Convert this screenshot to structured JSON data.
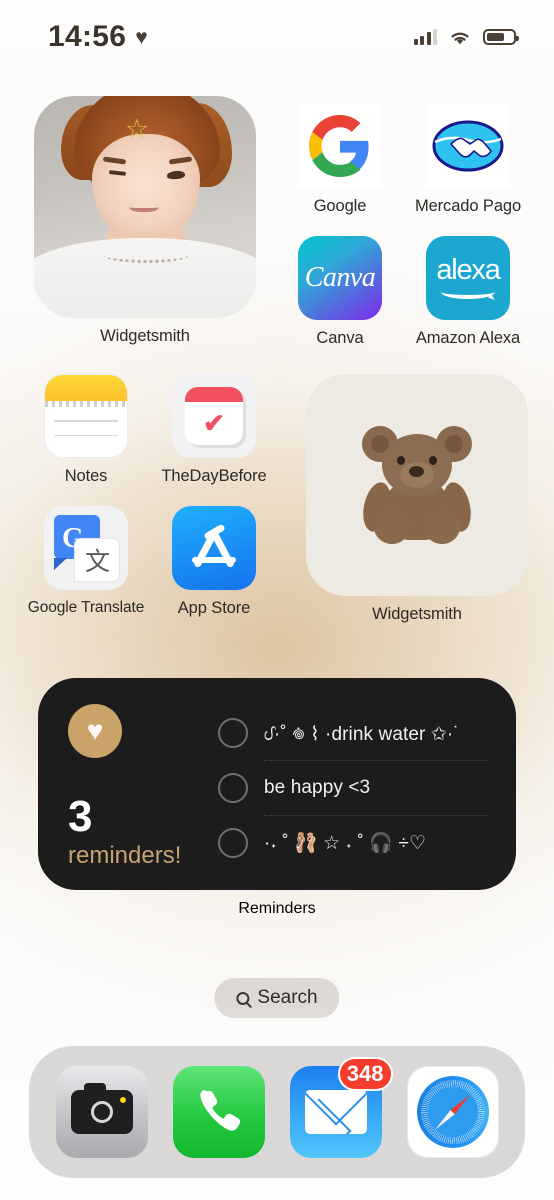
{
  "status_bar": {
    "time": "14:56",
    "heart_glyph": "♥",
    "signal_icon": "cellular-signal-icon",
    "wifi_icon": "wifi-icon",
    "battery_icon": "battery-icon"
  },
  "home_screen": {
    "widgets": {
      "photo_person": {
        "label": "Widgetsmith"
      },
      "photo_bear": {
        "label": "Widgetsmith"
      },
      "reminders": {
        "label": "Reminders",
        "count": "3",
        "count_word": "reminders!",
        "badge_icon": "heart-icon",
        "items": [
          {
            "text": "ᦔ·˚ ݁𖦹 ⌇ ·drink water ✩·˙"
          },
          {
            "text": "be happy <3"
          },
          {
            "text": "·˖ ˚ 🩰 ☆ ˖ ˚ 🎧 ÷♡"
          }
        ]
      }
    },
    "apps": [
      {
        "name": "Google",
        "icon": "google-icon"
      },
      {
        "name": "Mercado Pago",
        "icon": "mercado-pago-icon"
      },
      {
        "name": "Canva",
        "icon": "canva-icon",
        "wordmark": "Canva"
      },
      {
        "name": "Amazon Alexa",
        "icon": "amazon-alexa-icon",
        "wordmark": "alexa"
      },
      {
        "name": "Notes",
        "icon": "notes-icon"
      },
      {
        "name": "TheDayBefore",
        "icon": "thedaybefore-icon"
      },
      {
        "name": "Google Translate",
        "icon": "google-translate-icon"
      },
      {
        "name": "App Store",
        "icon": "app-store-icon"
      }
    ]
  },
  "search": {
    "label": "Search",
    "icon": "search-icon"
  },
  "dock": {
    "apps": [
      {
        "name": "Camera",
        "icon": "camera-icon"
      },
      {
        "name": "Phone",
        "icon": "phone-icon",
        "glyph": "📞"
      },
      {
        "name": "Mail",
        "icon": "mail-icon",
        "badge": "348"
      },
      {
        "name": "Safari",
        "icon": "safari-icon"
      }
    ]
  },
  "colors": {
    "reminders_background": "#1C1C1C",
    "reminders_accent": "#C9A368",
    "bear_widget_background": "#EDEAE3",
    "badge_red": "#F53D2E",
    "wallpaper_warm": "#D6B78A"
  }
}
